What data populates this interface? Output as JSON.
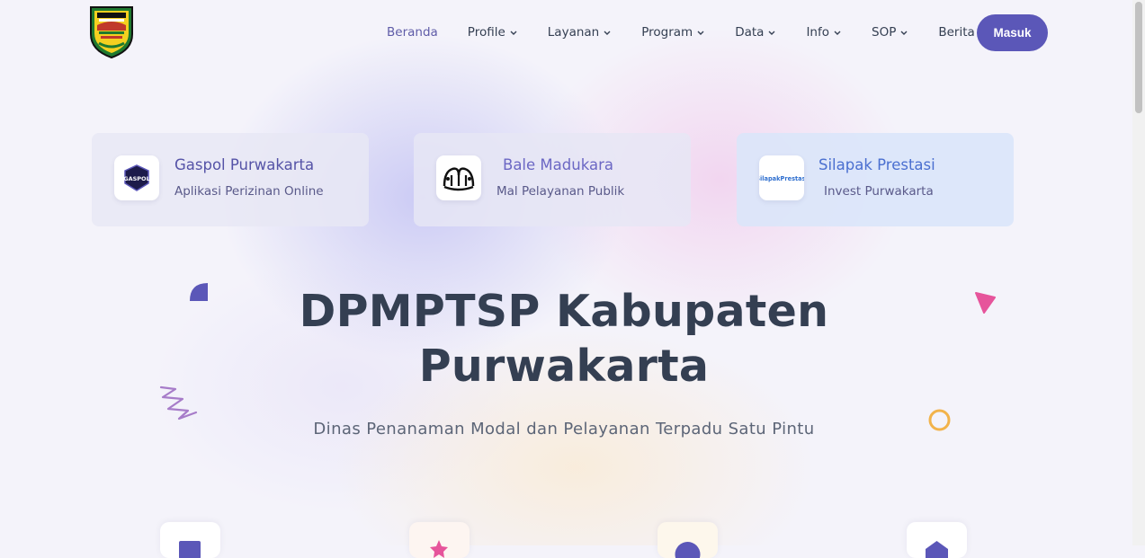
{
  "header": {
    "logo_icon": "purwakarta-regency-crest-icon",
    "nav": [
      {
        "label": "Beranda",
        "dropdown": false,
        "active": true
      },
      {
        "label": "Profile",
        "dropdown": true
      },
      {
        "label": "Layanan",
        "dropdown": true
      },
      {
        "label": "Program",
        "dropdown": true
      },
      {
        "label": "Data",
        "dropdown": true
      },
      {
        "label": "Info",
        "dropdown": true
      },
      {
        "label": "SOP",
        "dropdown": true
      },
      {
        "label": "Berita",
        "dropdown": false
      }
    ],
    "login_label": "Masuk"
  },
  "cards": [
    {
      "title": "Gaspol Purwakarta",
      "subtitle": "Aplikasi Perizinan Online",
      "icon": "gaspol-shield-icon",
      "icon_text": "GASPOL"
    },
    {
      "title": "Bale Madukara",
      "subtitle": "Mal Pelayanan Publik",
      "icon": "bale-madukara-ornament-icon"
    },
    {
      "title": "Silapak Prestasi",
      "subtitle": "Invest Purwakarta",
      "icon": "silapak-prestasi-logo-icon",
      "icon_text": "SilapakPrestasi"
    }
  ],
  "hero": {
    "title_line1": "DPMPTSP Kabupaten",
    "title_line2": "Purwakarta",
    "subtitle": "Dinas Penanaman Modal dan Pelayanan Terpadu Satu Pintu"
  },
  "decorations": [
    "quarter-circle-icon",
    "triangle-icon",
    "squiggle-icon",
    "ring-icon"
  ],
  "feature_icons": [
    "feature-box-icon-1",
    "feature-box-icon-2",
    "feature-box-icon-3",
    "feature-box-icon-4"
  ],
  "colors": {
    "accent": "#5b57b8",
    "card_title_1": "#5553a7",
    "card_title_2": "#6b67c4",
    "card_title_3": "#4a6fd0",
    "text_dark": "#343f52",
    "triangle": "#e6549b",
    "ring": "#f2b34b"
  }
}
